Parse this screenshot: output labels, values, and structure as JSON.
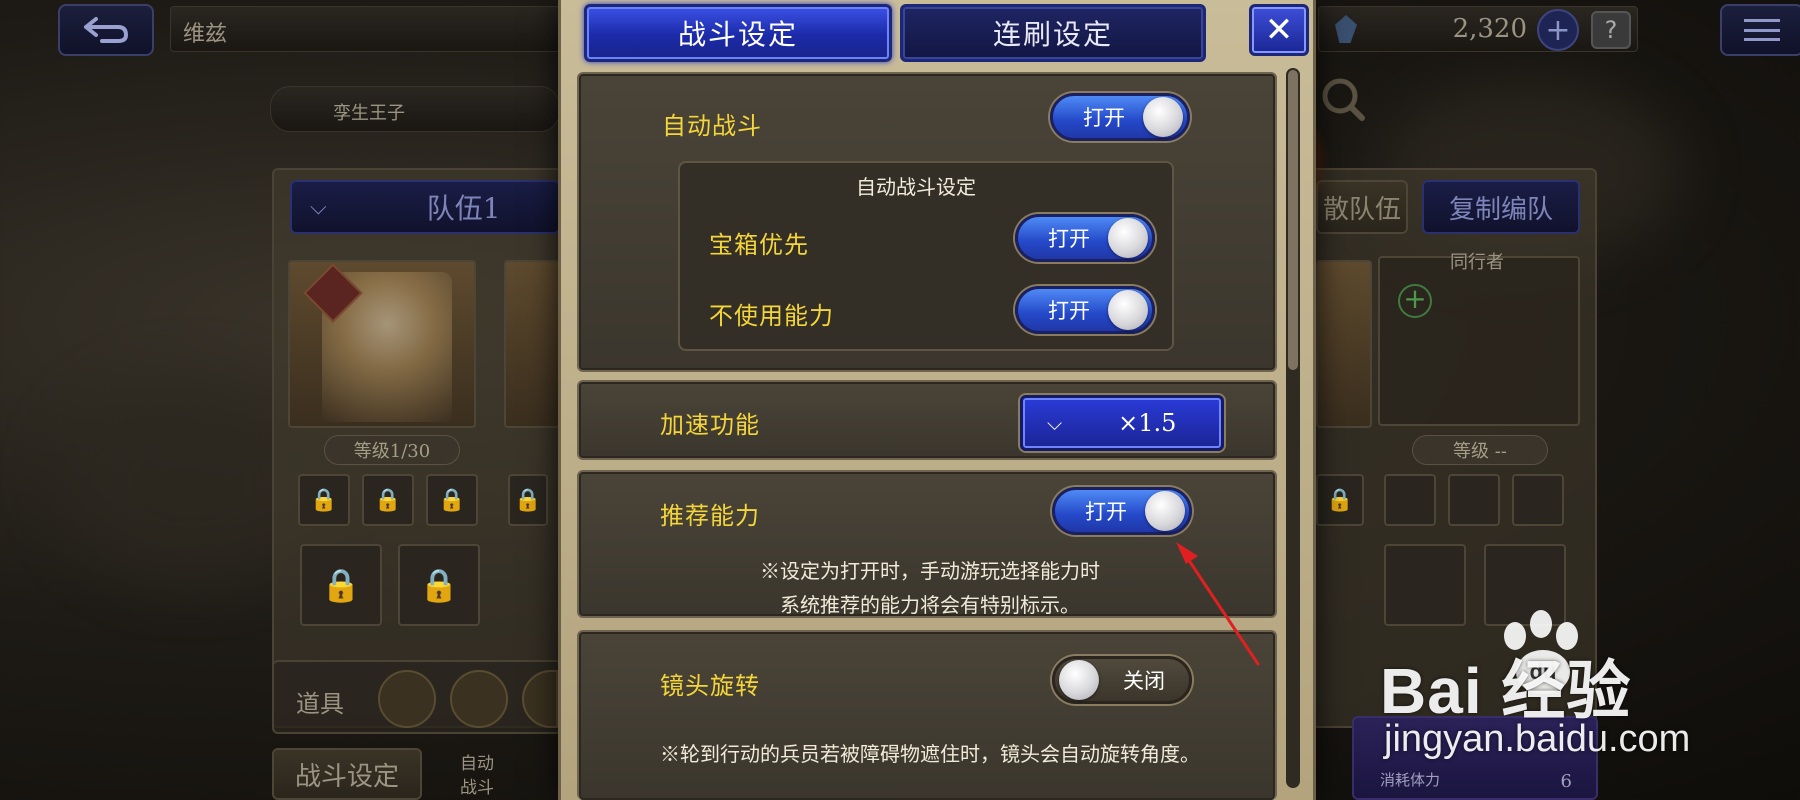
{
  "background": {
    "location_name": "维兹",
    "sub_title": "孪生王子",
    "currency_amount": "2,320",
    "party_tab": "队伍1",
    "disband_label": "散队伍",
    "copy_team_label": "复制编队",
    "companion_label": "同行者",
    "level_text_1": "等级1/30",
    "level_text_2": "等级 --",
    "items_label": "道具",
    "battle_settings_button": "战斗设定",
    "auto_battle_small_line1": "自动",
    "auto_battle_small_line2": "战斗",
    "stamina_label": "消耗体力",
    "stamina_value": "6"
  },
  "modal": {
    "tabs": [
      {
        "label": "战斗设定",
        "active": true
      },
      {
        "label": "连刷设定",
        "active": false
      }
    ],
    "close_glyph": "✕",
    "auto_battle": {
      "label": "自动战斗",
      "toggle": {
        "text": "打开",
        "state": "on"
      }
    },
    "auto_battle_settings": {
      "title": "自动战斗设定",
      "chest_priority": {
        "label": "宝箱优先",
        "toggle": {
          "text": "打开",
          "state": "on"
        }
      },
      "no_abilities": {
        "label": "不使用能力",
        "toggle": {
          "text": "打开",
          "state": "on"
        }
      }
    },
    "speed": {
      "label": "加速功能",
      "value": "×1.5"
    },
    "recommend": {
      "label": "推荐能力",
      "toggle": {
        "text": "打开",
        "state": "on"
      },
      "note_line1": "※设定为打开时，手动游玩选择能力时",
      "note_line2": "系统推荐的能力将会有特别标示。"
    },
    "camera": {
      "label": "镜头旋转",
      "toggle": {
        "text": "关闭",
        "state": "off"
      },
      "note": "※轮到行动的兵员若被障碍物遮住时，镜头会自动旋转角度。"
    }
  },
  "colors": {
    "accent_yellow": "#f4d53a",
    "toggle_on_blue": "#2448c8",
    "annotation_red": "#e02020"
  },
  "watermark": {
    "logo": "Bai  经验",
    "url": "jingyan.baidu.com"
  }
}
